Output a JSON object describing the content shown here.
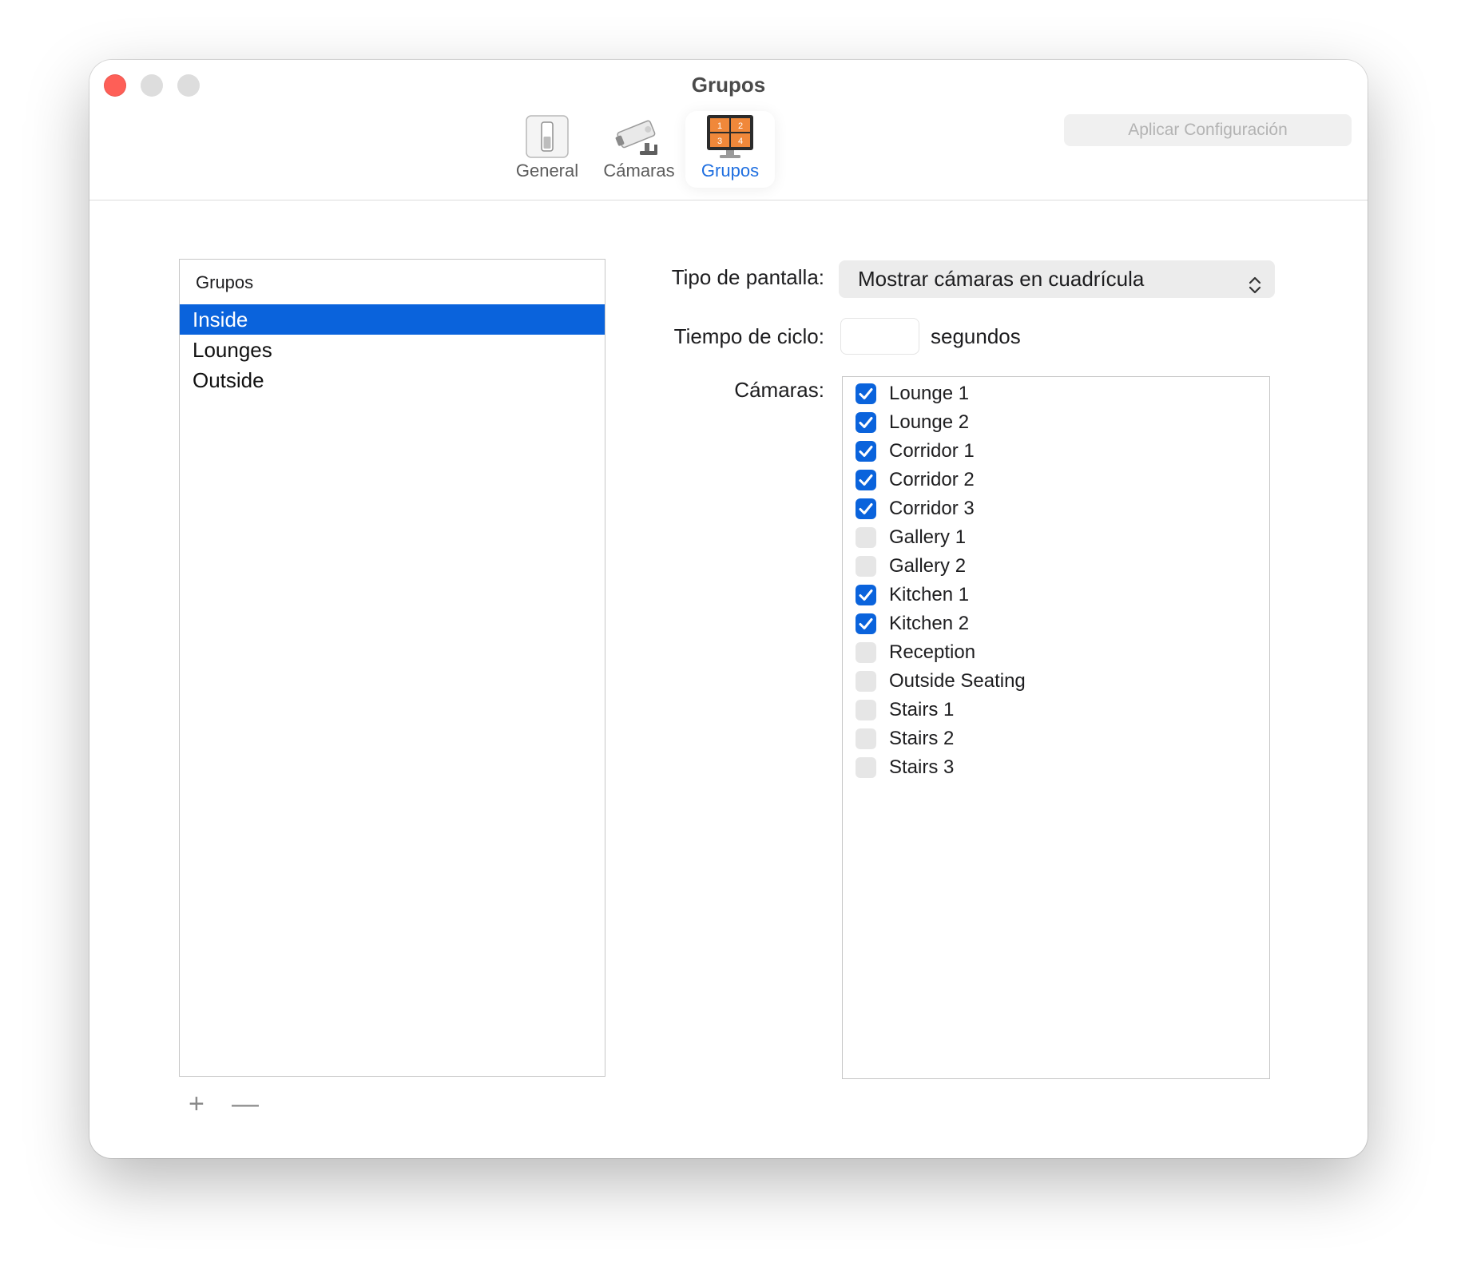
{
  "window": {
    "title": "Grupos"
  },
  "toolbar": {
    "apply_label": "Aplicar Configuración",
    "tabs": [
      {
        "label": "General",
        "icon": "switch-icon"
      },
      {
        "label": "Cámaras",
        "icon": "security-camera-icon"
      },
      {
        "label": "Grupos",
        "icon": "grid-monitor-icon",
        "selected": true,
        "grid_digits": [
          "1",
          "2",
          "3",
          "4"
        ]
      }
    ]
  },
  "groups": {
    "header": "Grupos",
    "items": [
      "Inside",
      "Lounges",
      "Outside"
    ],
    "selected": "Inside",
    "add_label": "+",
    "remove_label": "—"
  },
  "form": {
    "display_type_label": "Tipo de pantalla:",
    "display_type_value": "Mostrar cámaras en cuadrícula",
    "cycle_time_label": "Tiempo de ciclo:",
    "cycle_time_value": "",
    "cycle_time_unit": "segundos",
    "cameras_label": "Cámaras:"
  },
  "cameras": [
    {
      "name": "Lounge 1",
      "checked": true
    },
    {
      "name": "Lounge 2",
      "checked": true
    },
    {
      "name": "Corridor 1",
      "checked": true
    },
    {
      "name": "Corridor 2",
      "checked": true
    },
    {
      "name": "Corridor 3",
      "checked": true
    },
    {
      "name": "Gallery 1",
      "checked": false
    },
    {
      "name": "Gallery 2",
      "checked": false
    },
    {
      "name": "Kitchen 1",
      "checked": true
    },
    {
      "name": "Kitchen 2",
      "checked": true
    },
    {
      "name": "Reception",
      "checked": false
    },
    {
      "name": "Outside Seating",
      "checked": false
    },
    {
      "name": "Stairs 1",
      "checked": false
    },
    {
      "name": "Stairs 2",
      "checked": false
    },
    {
      "name": "Stairs 3",
      "checked": false
    }
  ],
  "colors": {
    "accent": "#0a63dc",
    "close_button": "#fe5f57",
    "tab_icon_orange": "#f0883a"
  }
}
